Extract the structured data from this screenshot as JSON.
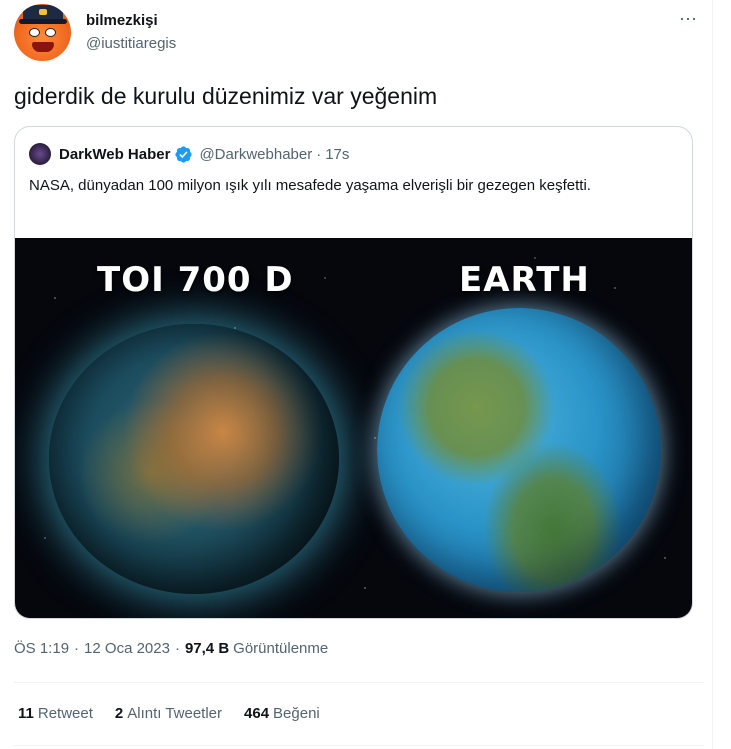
{
  "author": {
    "display_name": "bilmezkişi",
    "handle": "@iustitiaregis"
  },
  "tweet": {
    "text": "giderdik de kurulu düzenimiz var yeğenim",
    "more_icon": "⋯"
  },
  "quoted": {
    "display_name": "DarkWeb Haber",
    "verified": true,
    "handle": "@Darkwebhaber",
    "separator": "·",
    "time": "17s",
    "text": "NASA, dünyadan 100 milyon ışık yılı mesafede yaşama elverişli bir gezegen keşfetti.",
    "media": {
      "left_label": "TOI 700 D",
      "right_label": "EARTH"
    }
  },
  "meta": {
    "time": "ÖS 1:19",
    "separator": "·",
    "date": "12 Oca 2023",
    "views_count": "97,4 B",
    "views_label": "Görüntülenme"
  },
  "stats": [
    {
      "count": "11",
      "label": "Retweet"
    },
    {
      "count": "2",
      "label": "Alıntı Tweetler"
    },
    {
      "count": "464",
      "label": "Beğeni"
    }
  ],
  "colors": {
    "verified": "#1d9bf0",
    "secondary_text": "#536471",
    "border": "#cfd9de"
  }
}
